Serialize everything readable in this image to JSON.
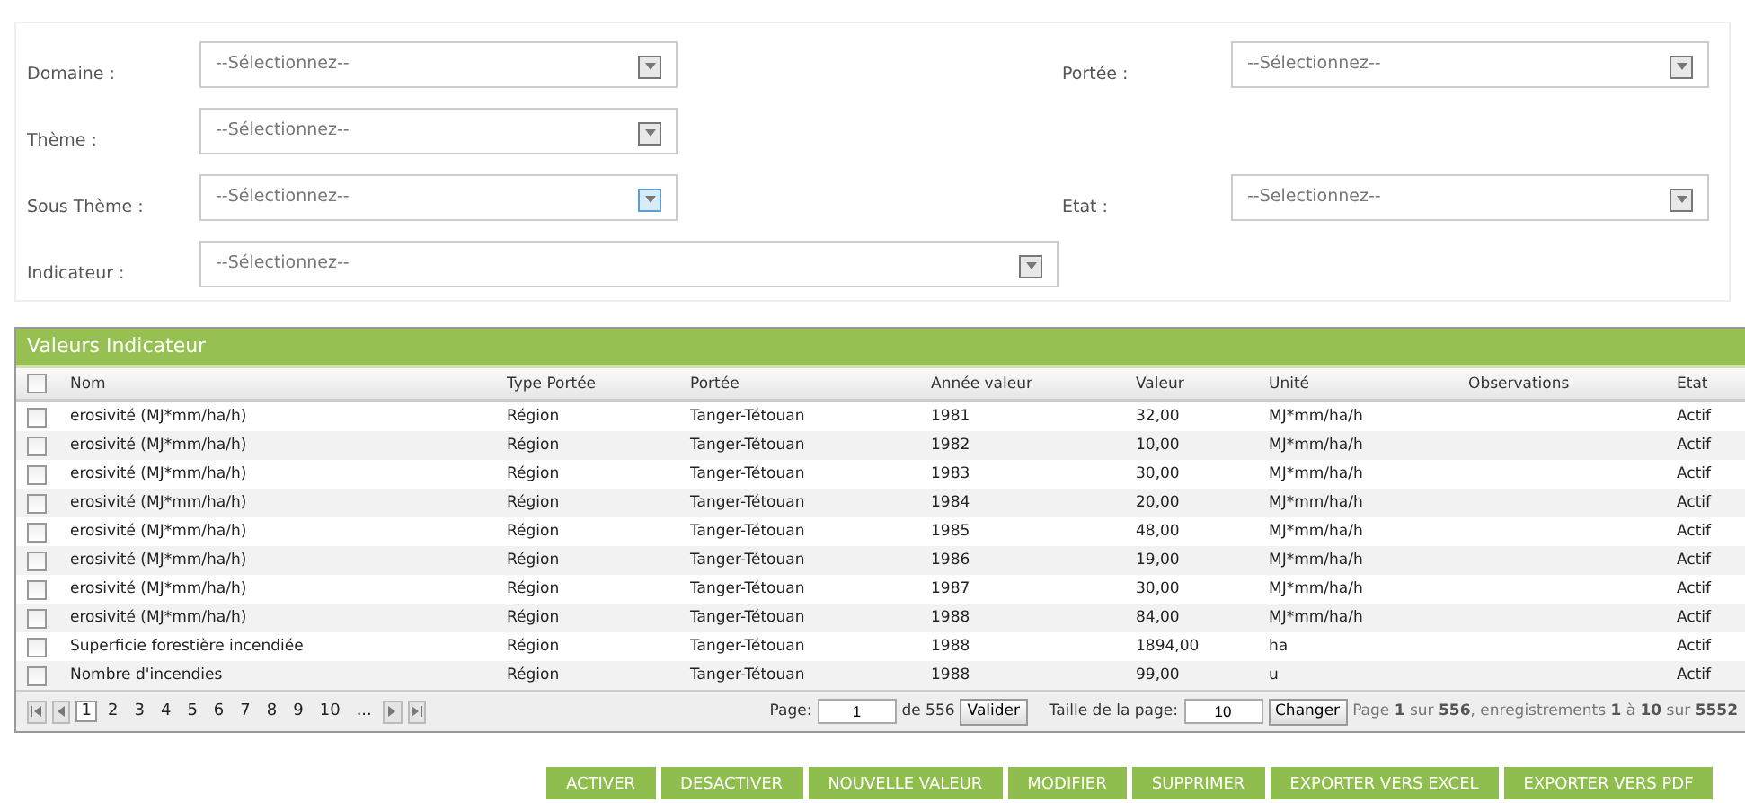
{
  "filter_rows": [
    {
      "fields": [
        {
          "kind": "normal",
          "label": "Domaine :",
          "value": "--Sélectionnez--",
          "highlighted": false
        },
        {
          "kind": "normal",
          "label": "Portée :",
          "value": "--Sélectionnez--",
          "highlighted": false
        }
      ]
    },
    {
      "fields": [
        {
          "kind": "normal",
          "label": "Thème :",
          "value": "--Sélectionnez--",
          "highlighted": false
        }
      ]
    },
    {
      "fields": [
        {
          "kind": "normal",
          "label": "Sous Thème :",
          "value": "--Sélectionnez--",
          "highlighted": true
        },
        {
          "kind": "normal",
          "label": "Etat :",
          "value": "--Selectionnez--",
          "highlighted": false
        }
      ]
    },
    {
      "fields": [
        {
          "kind": "wide",
          "label": "Indicateur :",
          "value": "--Sélectionnez--",
          "highlighted": false
        }
      ]
    }
  ],
  "grid": {
    "title": "Valeurs Indicateur",
    "all_checked": false,
    "columns": [
      "Nom",
      "Type Portée",
      "Portée",
      "Année valeur",
      "Valeur",
      "Unité",
      "Observations",
      "Etat"
    ],
    "rows": [
      {
        "checked": false,
        "cells": [
          "erosivité (MJ*mm/ha/h)",
          "Région",
          "Tanger-Tétouan",
          "1981",
          "32,00",
          "MJ*mm/ha/h",
          "",
          "Actif"
        ]
      },
      {
        "checked": false,
        "cells": [
          "erosivité (MJ*mm/ha/h)",
          "Région",
          "Tanger-Tétouan",
          "1982",
          "10,00",
          "MJ*mm/ha/h",
          "",
          "Actif"
        ]
      },
      {
        "checked": false,
        "cells": [
          "erosivité (MJ*mm/ha/h)",
          "Région",
          "Tanger-Tétouan",
          "1983",
          "30,00",
          "MJ*mm/ha/h",
          "",
          "Actif"
        ]
      },
      {
        "checked": false,
        "cells": [
          "erosivité (MJ*mm/ha/h)",
          "Région",
          "Tanger-Tétouan",
          "1984",
          "20,00",
          "MJ*mm/ha/h",
          "",
          "Actif"
        ]
      },
      {
        "checked": false,
        "cells": [
          "erosivité (MJ*mm/ha/h)",
          "Région",
          "Tanger-Tétouan",
          "1985",
          "48,00",
          "MJ*mm/ha/h",
          "",
          "Actif"
        ]
      },
      {
        "checked": false,
        "cells": [
          "erosivité (MJ*mm/ha/h)",
          "Région",
          "Tanger-Tétouan",
          "1986",
          "19,00",
          "MJ*mm/ha/h",
          "",
          "Actif"
        ]
      },
      {
        "checked": false,
        "cells": [
          "erosivité (MJ*mm/ha/h)",
          "Région",
          "Tanger-Tétouan",
          "1987",
          "30,00",
          "MJ*mm/ha/h",
          "",
          "Actif"
        ]
      },
      {
        "checked": false,
        "cells": [
          "erosivité (MJ*mm/ha/h)",
          "Région",
          "Tanger-Tétouan",
          "1988",
          "84,00",
          "MJ*mm/ha/h",
          "",
          "Actif"
        ]
      },
      {
        "checked": false,
        "cells": [
          "Superficie forestière incendiée",
          "Région",
          "Tanger-Tétouan",
          "1988",
          "1894,00",
          "ha",
          "",
          "Actif"
        ]
      },
      {
        "checked": false,
        "cells": [
          "Nombre d'incendies",
          "Région",
          "Tanger-Tétouan",
          "1988",
          "99,00",
          "u",
          "",
          "Actif"
        ]
      }
    ],
    "pager": {
      "pages": [
        {
          "label": "1",
          "selected": true
        },
        {
          "label": "2",
          "selected": false
        },
        {
          "label": "3",
          "selected": false
        },
        {
          "label": "4",
          "selected": false
        },
        {
          "label": "5",
          "selected": false
        },
        {
          "label": "6",
          "selected": false
        },
        {
          "label": "7",
          "selected": false
        },
        {
          "label": "8",
          "selected": false
        },
        {
          "label": "9",
          "selected": false
        },
        {
          "label": "10",
          "selected": false
        },
        {
          "label": "...",
          "selected": false
        }
      ],
      "page_label": "Page:",
      "page_value": "1",
      "page_of": "de 556",
      "validate": "Valider",
      "size_label": "Taille de la page:",
      "size_value": "10",
      "change": "Changer",
      "summary": "Page **1** sur **556**, enregistrements **1** à **10** sur **5552**"
    }
  },
  "actions": [
    "ACTIVER",
    "DESACTIVER",
    "NOUVELLE VALEUR",
    "MODIFIER",
    "SUPPRIMER",
    "EXPORTER VERS EXCEL",
    "EXPORTER VERS PDF"
  ]
}
